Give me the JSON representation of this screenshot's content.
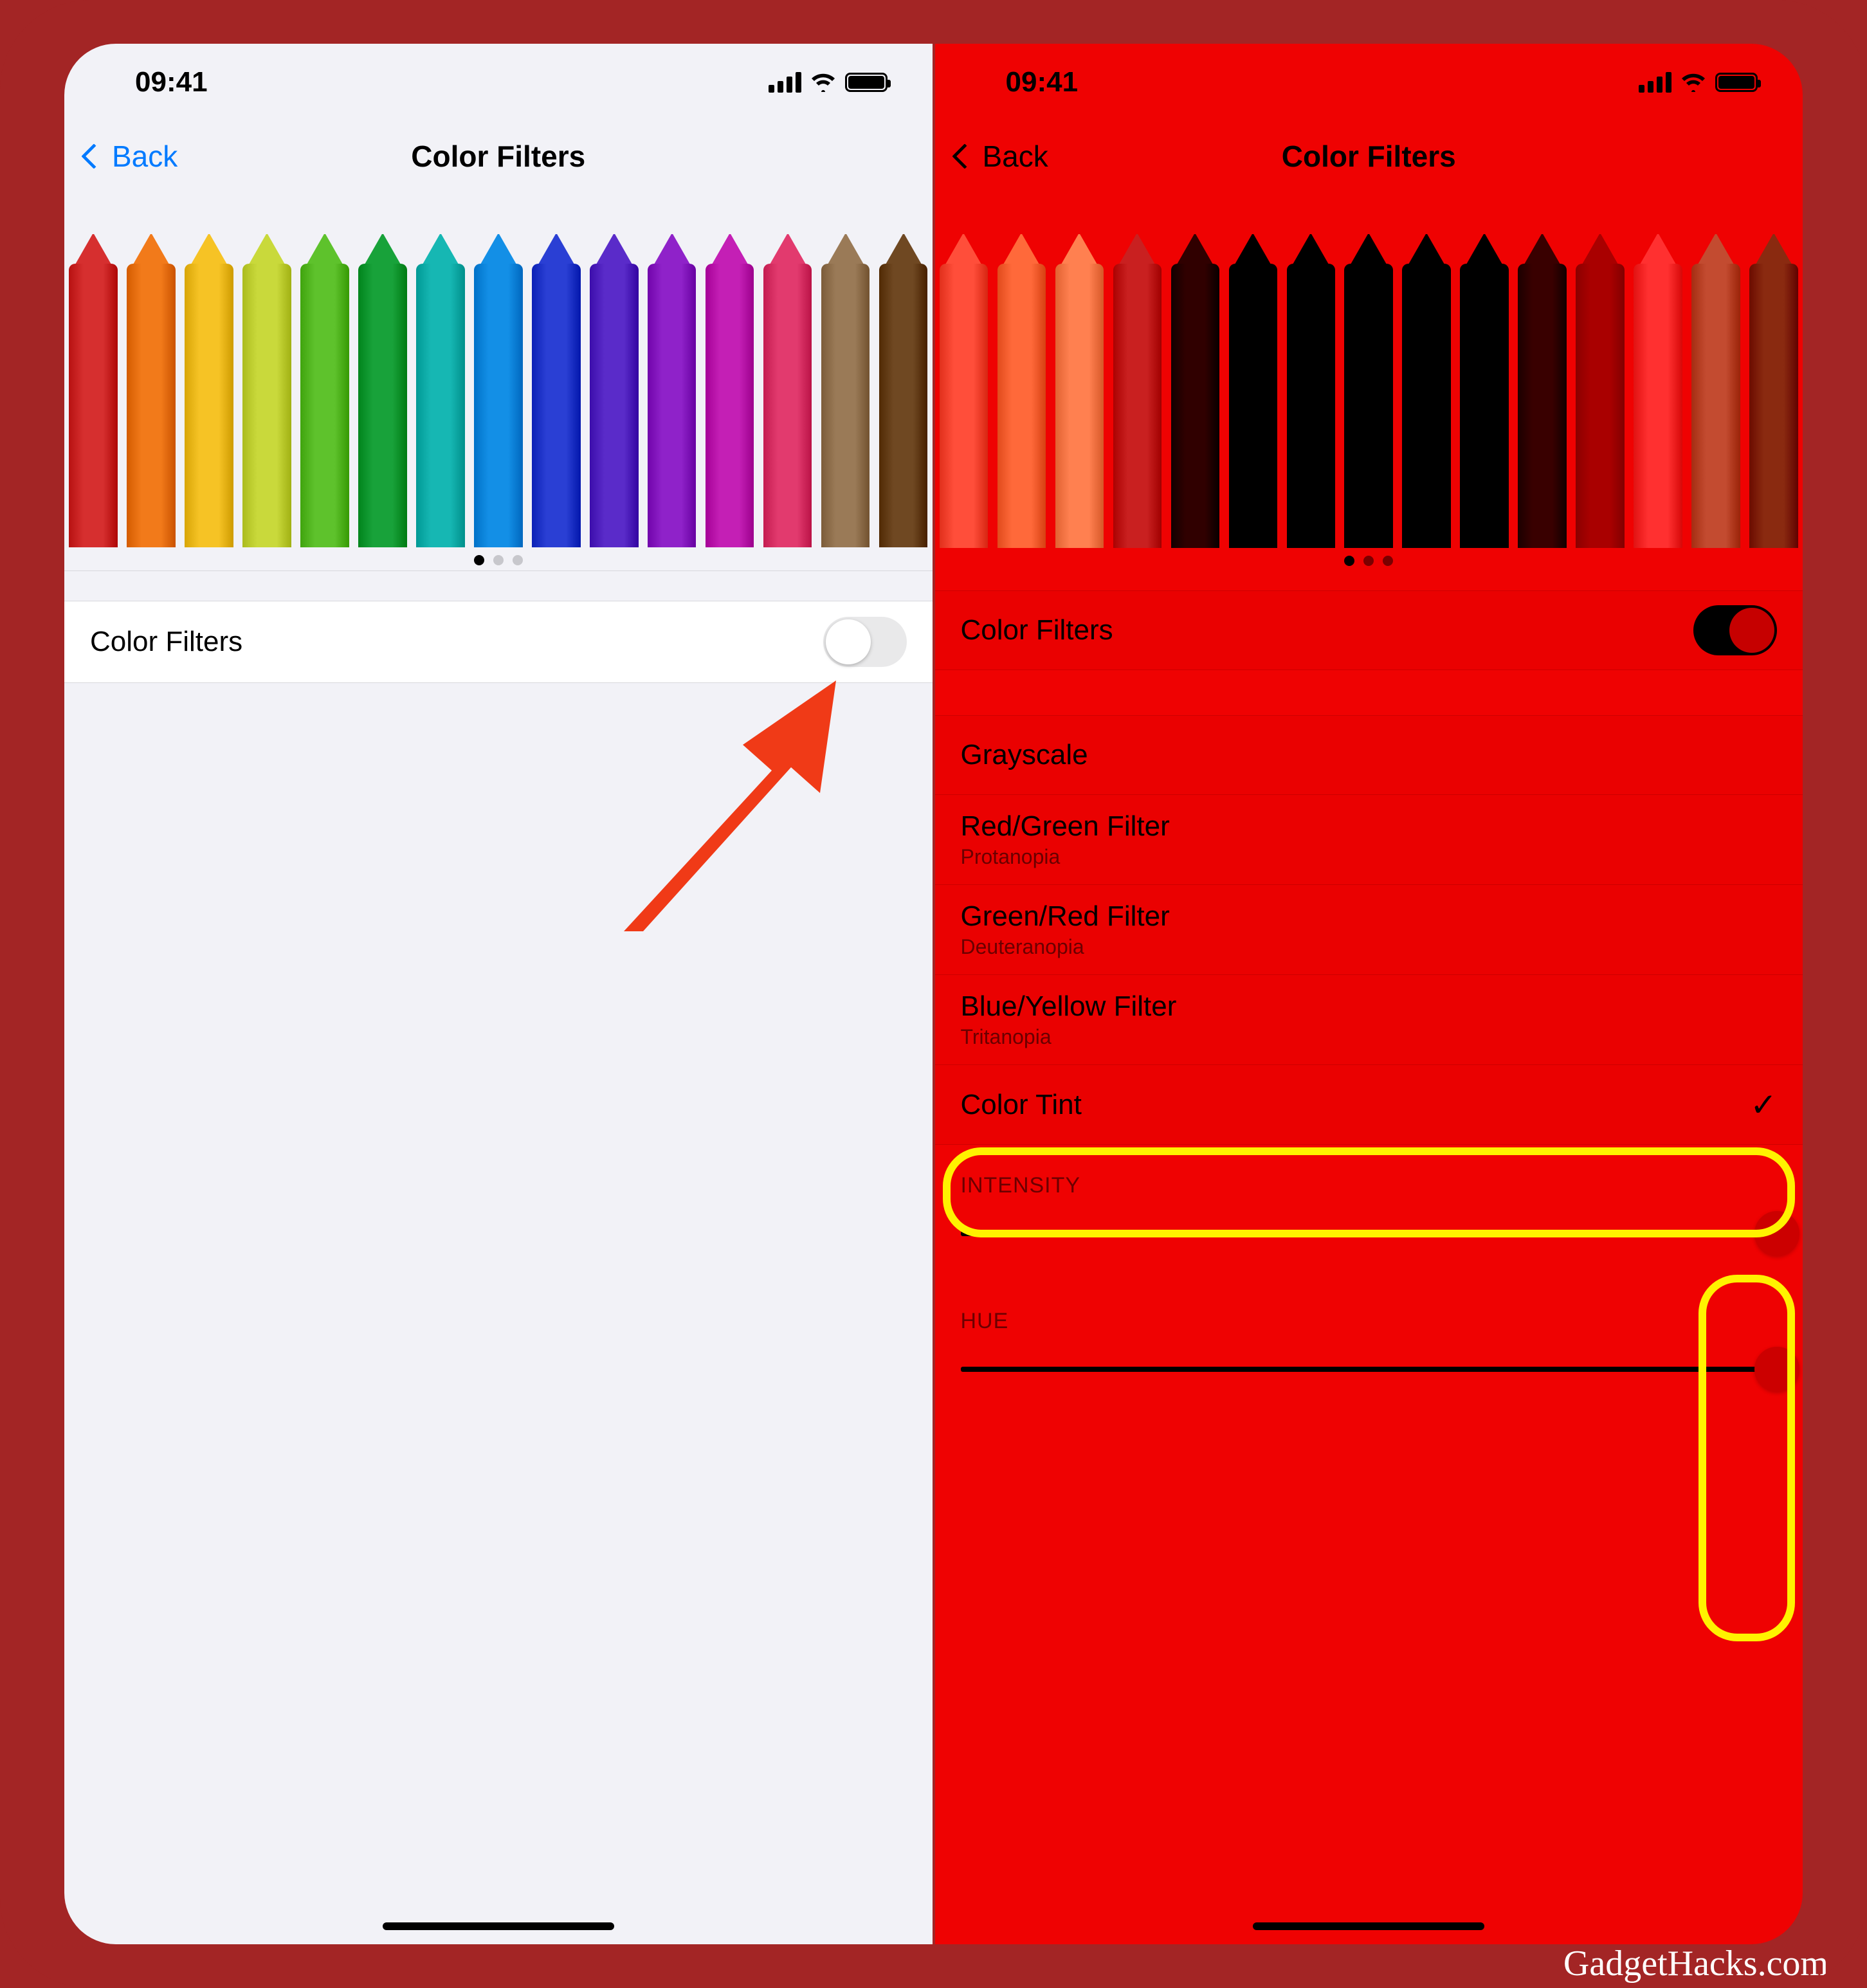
{
  "status": {
    "time": "09:41"
  },
  "nav": {
    "back_label": "Back",
    "title": "Color Filters"
  },
  "left": {
    "toggle": {
      "label": "Color Filters",
      "on": false
    },
    "pencil_colors": [
      "#d62f2f",
      "#f27a1a",
      "#f6c325",
      "#c9d93b",
      "#5ec22c",
      "#18a23a",
      "#16b7b3",
      "#138fe6",
      "#2a3fd4",
      "#5a2bc9",
      "#8f22c9",
      "#c41fb5",
      "#e23a6e",
      "#9a7a57",
      "#6f4822"
    ],
    "page_active": 0
  },
  "right": {
    "toggle": {
      "label": "Color Filters",
      "on": true
    },
    "options": [
      {
        "title": "Grayscale",
        "sub": null,
        "selected": false
      },
      {
        "title": "Red/Green Filter",
        "sub": "Protanopia",
        "selected": false
      },
      {
        "title": "Green/Red Filter",
        "sub": "Deuteranopia",
        "selected": false
      },
      {
        "title": "Blue/Yellow Filter",
        "sub": "Tritanopia",
        "selected": false
      },
      {
        "title": "Color Tint",
        "sub": null,
        "selected": true
      }
    ],
    "sliders": {
      "intensity": {
        "label": "INTENSITY",
        "value": 1.0
      },
      "hue": {
        "label": "HUE",
        "value": 1.0
      }
    },
    "pencil_colors": [
      "#ff4e3a",
      "#ff693a",
      "#ff8050",
      "#c92020",
      "#300000",
      "#000000",
      "#000000",
      "#000000",
      "#000000",
      "#000000",
      "#390000",
      "#a90000",
      "#ff3030",
      "#c34b30",
      "#8a2a10"
    ],
    "page_active": 0
  },
  "watermark": "GadgetHacks.com"
}
